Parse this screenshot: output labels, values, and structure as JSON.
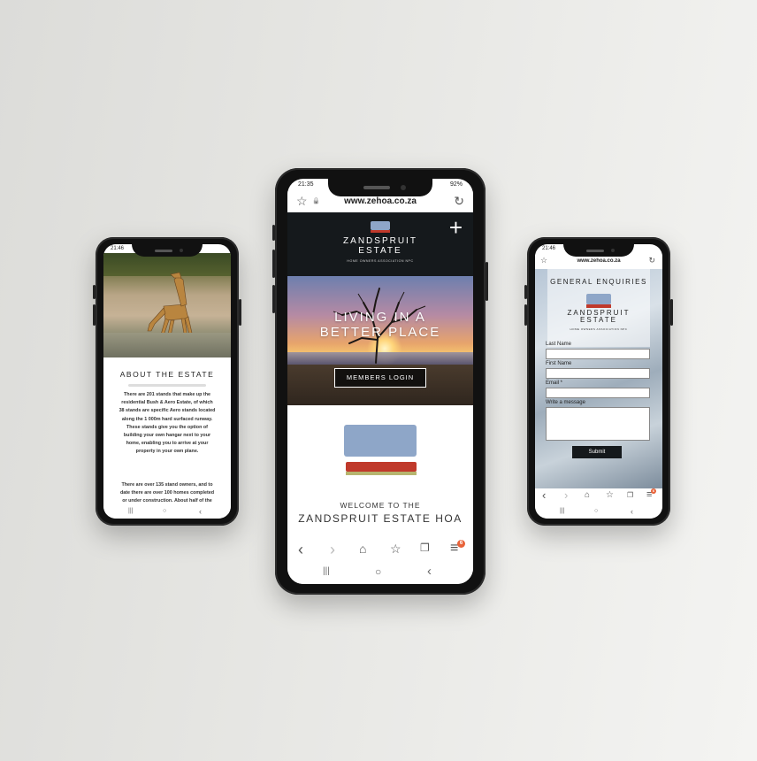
{
  "center": {
    "status_time": "21:35",
    "status_battery": "92%",
    "url": "www.zehoa.co.za",
    "brand_line1": "ZANDSPRUIT",
    "brand_line2": "ESTATE",
    "brand_sub": "HOME OWNERS ASSOCIATION NPC",
    "menu_glyph": "+",
    "hero_line1": "LIVING IN A",
    "hero_line2": "BETTER PLACE",
    "members_login": "MEMBERS LOGIN",
    "welcome_line1": "WELCOME TO THE",
    "welcome_line2": "ZANDSPRUIT ESTATE HOA",
    "tabs_badge": "6"
  },
  "left": {
    "status_time": "21:46",
    "about_title": "ABOUT THE ESTATE",
    "para1_lines": [
      "There are 201 stands that make up the",
      "residential Bush & Aero Estate, of which",
      "38 stands are specific Aero stands located",
      "along the 1 000m hard surfaced runway.",
      "These stands give you the option of",
      "building your own hangar next to your",
      "home, enabling you to arrive at your",
      "property in your own plane."
    ],
    "para2_lines": [
      "There are over 135 stand owners, and to",
      "date there are over 100 homes completed",
      "or under construction.  About half of the"
    ]
  },
  "right": {
    "status_time": "21:46",
    "url": "www.zehoa.co.za",
    "title": "GENERAL ENQUIRIES",
    "brand_line1": "ZANDSPRUIT",
    "brand_line2": "ESTATE",
    "brand_sub": "HOME OWNERS ASSOCIATION NPC",
    "labels": {
      "last_name": "Last Name",
      "first_name": "First Name",
      "email": "Email *",
      "message": "Write a message"
    },
    "submit": "Submit",
    "tabs_badge": "6"
  },
  "icons": {
    "star": "☆",
    "lock": "🔒",
    "reload": "↻",
    "back": "‹",
    "forward": "›",
    "home": "⌂",
    "bookmark": "☆",
    "tabs": "❐",
    "menu": "≡",
    "recent": "|||",
    "sys_home": "○",
    "sys_back": "‹"
  },
  "colors": {
    "logo_blue": "#8ea6c8",
    "logo_red": "#c0392b",
    "logo_green": "#b7b56f",
    "header_dark": "#15191c",
    "badge": "#e8633a"
  }
}
